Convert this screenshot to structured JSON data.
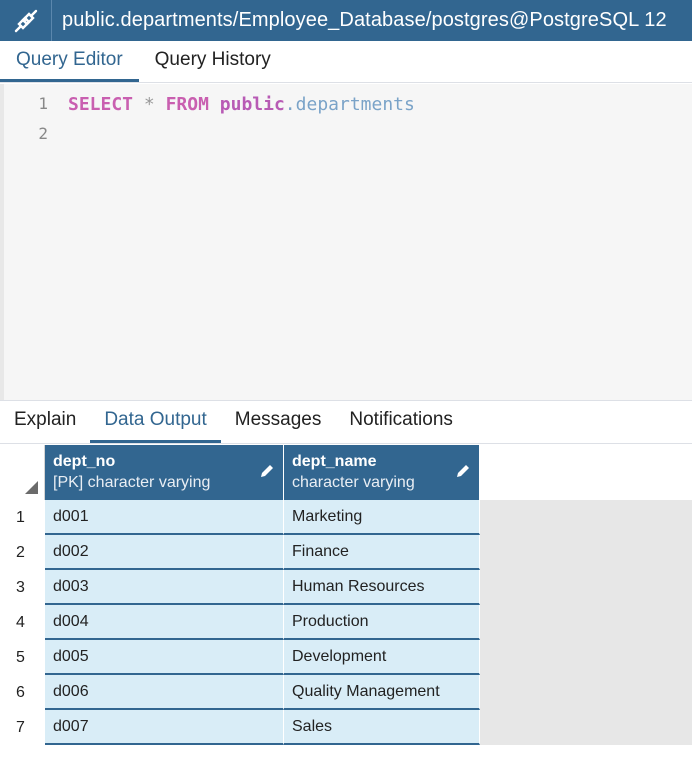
{
  "window": {
    "title": "public.departments/Employee_Database/postgres@PostgreSQL 12",
    "icon": "connection-plug-icon"
  },
  "top_tabs": [
    {
      "label": "Query Editor",
      "active": true
    },
    {
      "label": "Query History",
      "active": false
    }
  ],
  "editor": {
    "line_numbers": [
      "1",
      "2"
    ],
    "tokens": {
      "select": "SELECT",
      "star": "*",
      "from": "FROM",
      "schema": "public",
      "dot": ".",
      "table": "departments"
    }
  },
  "bottom_tabs": [
    {
      "label": "Explain",
      "active": false
    },
    {
      "label": "Data Output",
      "active": true
    },
    {
      "label": "Messages",
      "active": false
    },
    {
      "label": "Notifications",
      "active": false
    }
  ],
  "grid": {
    "columns": [
      {
        "name": "dept_no",
        "type": "[PK] character varying"
      },
      {
        "name": "dept_name",
        "type": "character varying"
      }
    ],
    "rows": [
      {
        "n": "1",
        "dept_no": "d001",
        "dept_name": "Marketing"
      },
      {
        "n": "2",
        "dept_no": "d002",
        "dept_name": "Finance"
      },
      {
        "n": "3",
        "dept_no": "d003",
        "dept_name": "Human Resources"
      },
      {
        "n": "4",
        "dept_no": "d004",
        "dept_name": "Production"
      },
      {
        "n": "5",
        "dept_no": "d005",
        "dept_name": "Development"
      },
      {
        "n": "6",
        "dept_no": "d006",
        "dept_name": "Quality Management"
      },
      {
        "n": "7",
        "dept_no": "d007",
        "dept_name": "Sales"
      }
    ]
  },
  "colors": {
    "accent": "#326690",
    "cell_background": "#d9edf7",
    "editor_background": "#f6f6f6"
  }
}
